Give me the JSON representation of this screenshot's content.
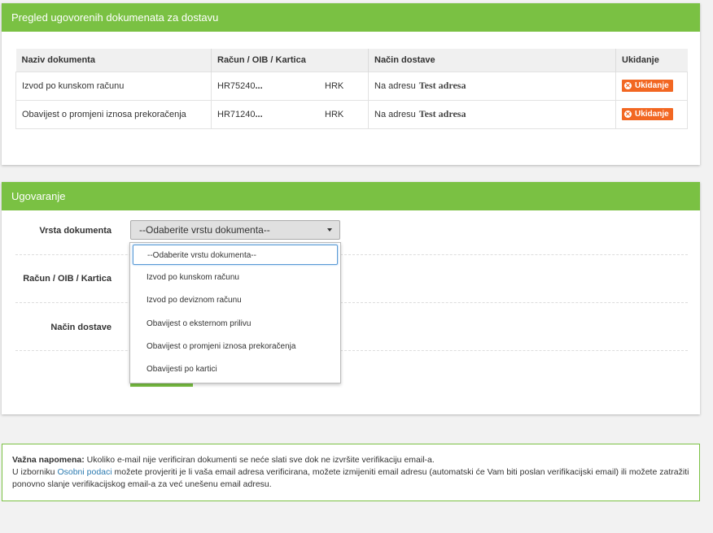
{
  "overview": {
    "title": "Pregled ugovorenih dokumenata za dostavu",
    "columns": [
      "Naziv dokumenta",
      "Račun / OIB / Kartica",
      "Način dostave",
      "Ukidanje"
    ],
    "rows": [
      {
        "name": "Izvod po kunskom računu",
        "account": "HR75240",
        "account_mask": "...",
        "currency": "HRK",
        "delivery_prefix": "Na adresu",
        "delivery_name": "Test adresa",
        "cancel_label": "Ukidanje"
      },
      {
        "name": "Obavijest o promjeni iznosa prekoračenja",
        "account": "HR71240",
        "account_mask": "...",
        "currency": "HRK",
        "delivery_prefix": "Na adresu",
        "delivery_name": "Test adresa",
        "cancel_label": "Ukidanje"
      }
    ]
  },
  "contract": {
    "title": "Ugovaranje",
    "labels": {
      "doc_type": "Vrsta dokumenta",
      "account": "Račun / OIB / Kartica",
      "delivery": "Način dostave"
    },
    "select": {
      "value": "--Odaberite vrstu dokumenta--"
    },
    "options": [
      "--Odaberite vrstu dokumenta--",
      "Izvod po kunskom računu",
      "Izvod po deviznom računu",
      "Obavijest o eksternom prilivu",
      "Obavijest o promjeni iznosa prekoračenja",
      "Obavijesti po kartici"
    ]
  },
  "notice": {
    "bold": "Važna napomena:",
    "line1": " Ukoliko e-mail nije verificiran dokumenti se neće slati sve dok ne izvršite verifikaciju email-a.",
    "line2_pre": "U izborniku ",
    "link": "Osobni podaci",
    "line2_post": " možete provjeriti je li vaša email adresa verificirana, možete izmijeniti email adresu (automatski će Vam biti poslan verifikacijski email) ili možete zatražiti ponovno slanje verifikacijskog email-a za već unešenu email adresu."
  },
  "colors": {
    "brand_green": "#7ac143",
    "cancel_orange": "#f26722",
    "link_blue": "#2a7ab0"
  },
  "icons": {
    "cancel": "x-circle-icon",
    "select_caret": "caret-down-icon"
  }
}
